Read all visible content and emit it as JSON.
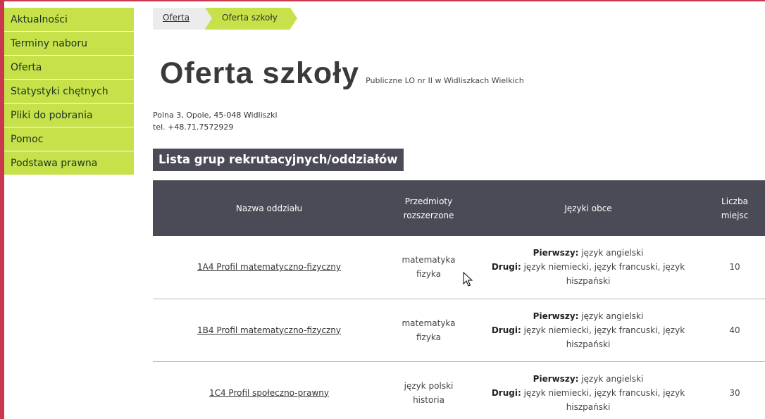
{
  "sidebar": {
    "items": [
      {
        "label": "Aktualności"
      },
      {
        "label": "Terminy naboru"
      },
      {
        "label": "Oferta"
      },
      {
        "label": "Statystyki chętnych"
      },
      {
        "label": "Pliki do pobrania"
      },
      {
        "label": "Pomoc"
      },
      {
        "label": "Podstawa prawna"
      }
    ]
  },
  "breadcrumb": {
    "items": [
      {
        "label": "Oferta"
      },
      {
        "label": "Oferta szkoły"
      }
    ]
  },
  "page": {
    "title": "Oferta szkoły",
    "subtitle": "Publiczne LO nr II w Widliszkach Wielkich",
    "address_line1": "Polna 3, Opole, 45-048 Widliszki",
    "address_line2": "tel. +48.71.7572929"
  },
  "section": {
    "title": "Lista grup rekrutacyjnych/oddziałów"
  },
  "table": {
    "headers": {
      "name": "Nazwa oddziału",
      "subjects_1": "Przedmioty",
      "subjects_2": "rozszerzone",
      "languages": "Języki obce",
      "count_1": "Liczba",
      "count_2": "miejsc"
    },
    "labels": {
      "first": "Pierwszy:",
      "second": "Drugi:"
    },
    "rows": [
      {
        "name": "1A4 Profil matematyczno-fizyczny",
        "subject_1": "matematyka",
        "subject_2": "fizyka",
        "first_lang": " język angielski",
        "second_lang_1": " język niemiecki, język francuski, język",
        "second_lang_2": "hiszpański",
        "count": "10"
      },
      {
        "name": "1B4 Profil matematyczno-fizyczny",
        "subject_1": "matematyka",
        "subject_2": "fizyka",
        "first_lang": " język angielski",
        "second_lang_1": " język niemiecki, język francuski, język",
        "second_lang_2": "hiszpański",
        "count": "40"
      },
      {
        "name": "1C4 Profil społeczno-prawny",
        "subject_1": "język polski",
        "subject_2": "historia",
        "first_lang": " język angielski",
        "second_lang_1": " język niemiecki, język francuski, język",
        "second_lang_2": "hiszpański",
        "count": "30"
      }
    ]
  },
  "colors": {
    "accent": "#c6e14a",
    "header_bg": "#4b4b57",
    "frame": "#c8384e"
  }
}
